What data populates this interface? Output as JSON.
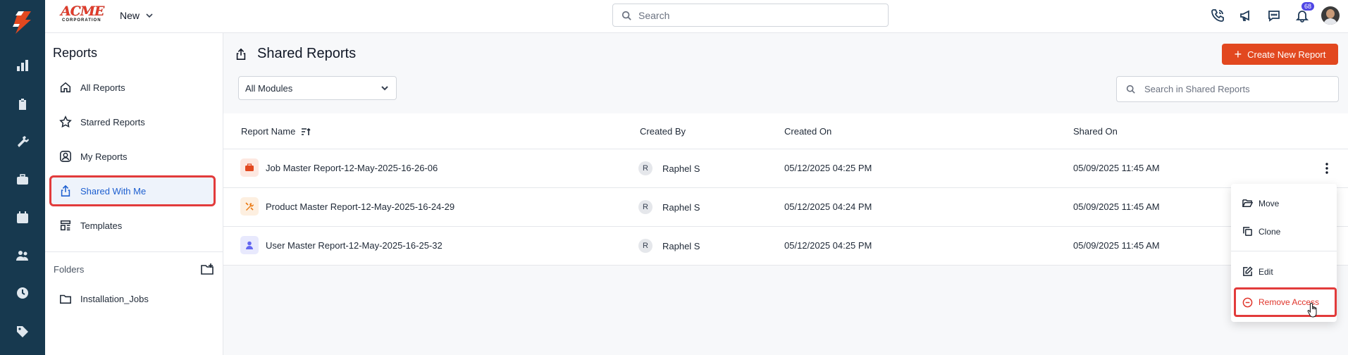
{
  "rail": {
    "items": [
      {
        "icon": "bar-chart-icon"
      },
      {
        "icon": "clipboard-icon"
      },
      {
        "icon": "tools-icon"
      },
      {
        "icon": "briefcase-icon"
      },
      {
        "icon": "calendar-icon"
      },
      {
        "icon": "users-icon"
      },
      {
        "icon": "clock-icon"
      },
      {
        "icon": "tag-icon"
      }
    ]
  },
  "topbar": {
    "brand_line1": "ACME",
    "brand_line2": "CORPORATION",
    "new_label": "New",
    "search_placeholder": "Search",
    "notification_count": "68"
  },
  "sidebar": {
    "title": "Reports",
    "items": [
      {
        "label": "All Reports",
        "icon": "home-icon"
      },
      {
        "label": "Starred Reports",
        "icon": "star-icon"
      },
      {
        "label": "My Reports",
        "icon": "user-circle-icon"
      },
      {
        "label": "Shared With Me",
        "icon": "share-icon",
        "active": true
      },
      {
        "label": "Templates",
        "icon": "template-icon"
      }
    ],
    "folders_label": "Folders",
    "folders": [
      {
        "label": "Installation_Jobs",
        "icon": "folder-icon"
      }
    ]
  },
  "main": {
    "title": "Shared Reports",
    "create_label": "Create New Report",
    "module_select": "All Modules",
    "search_placeholder": "Search in Shared Reports",
    "columns": [
      "Report Name",
      "Created By",
      "Created On",
      "Shared On"
    ],
    "rows": [
      {
        "name": "Job Master Report-12-May-2025-16-26-06",
        "initial": "R",
        "created_by": "Raphel S",
        "created_on": "05/12/2025 04:25 PM",
        "shared_on": "05/09/2025 11:45 AM",
        "icon": "briefcase-icon",
        "icon_color": "#e2481f",
        "icon_bg": "#fde8e1"
      },
      {
        "name": "Product Master Report-12-May-2025-16-24-29",
        "initial": "R",
        "created_by": "Raphel S",
        "created_on": "05/12/2025 04:24 PM",
        "shared_on": "05/09/2025 11:45 AM",
        "icon": "tools-icon",
        "icon_color": "#ea7a14",
        "icon_bg": "#fdefe0"
      },
      {
        "name": "User Master Report-12-May-2025-16-25-32",
        "initial": "R",
        "created_by": "Raphel S",
        "created_on": "05/12/2025 04:25 PM",
        "shared_on": "05/09/2025 11:45 AM",
        "icon": "user-icon",
        "icon_color": "#6366f1",
        "icon_bg": "#e8e9fd"
      }
    ]
  },
  "menu": {
    "items": [
      {
        "label": "Move",
        "icon": "folder-open-icon"
      },
      {
        "label": "Clone",
        "icon": "copy-icon"
      },
      {
        "label": "Edit",
        "icon": "edit-icon"
      },
      {
        "label": "Remove Access",
        "icon": "minus-circle-icon"
      }
    ]
  },
  "colors": {
    "accent": "#e2481f",
    "rail": "#17394f",
    "highlight": "#e23b3b",
    "active_nav": "#1d5fd0"
  }
}
